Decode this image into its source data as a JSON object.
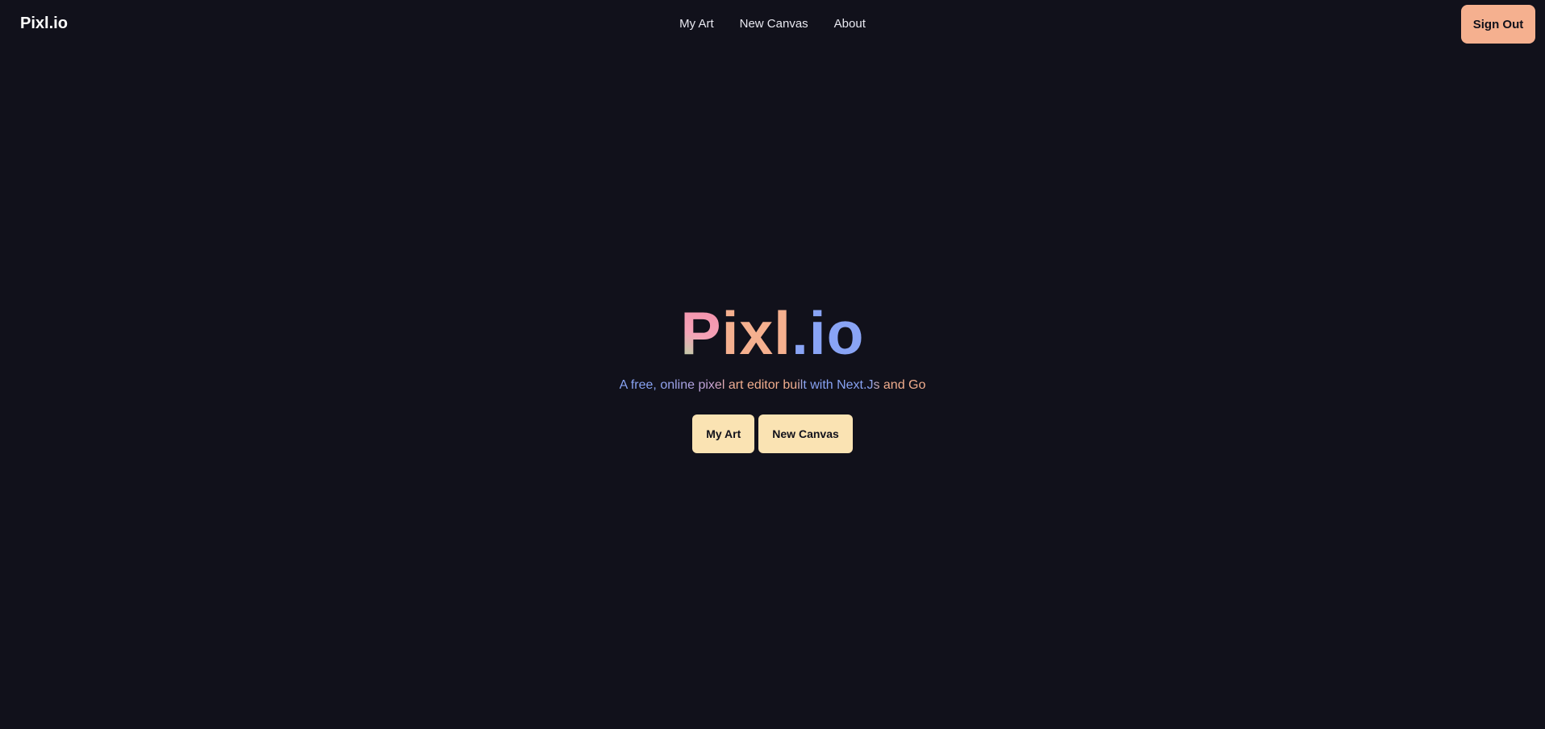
{
  "brand": {
    "name": "Pixl.io"
  },
  "nav": {
    "links": [
      {
        "label": "My Art"
      },
      {
        "label": "New Canvas"
      },
      {
        "label": "About"
      }
    ],
    "sign_out_label": "Sign Out"
  },
  "hero": {
    "title_parts": [
      "P",
      "ixl",
      ".io"
    ],
    "subtitle": "A free, online pixel art editor built with Next.Js and Go",
    "buttons": [
      {
        "label": "My Art"
      },
      {
        "label": "New Canvas"
      }
    ]
  },
  "colors": {
    "background": "#11111b",
    "accent_peach": "#f5b08f",
    "accent_blue": "#89a4f5",
    "accent_pink": "#f38ba8",
    "accent_green": "#a6e3a1",
    "button_cream": "#fae3b3"
  }
}
